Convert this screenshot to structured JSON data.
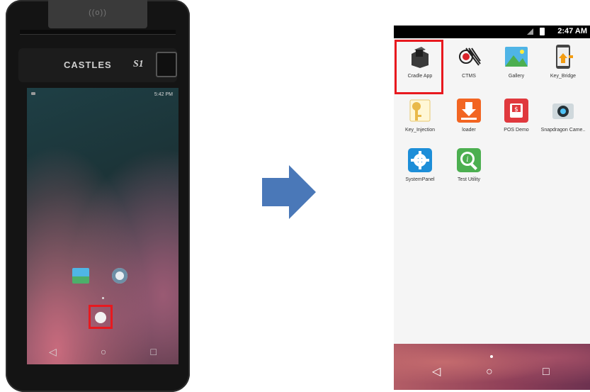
{
  "left_device": {
    "brand": "CASTLES",
    "model": "S1",
    "status_time": "5:42 PM"
  },
  "right_screen": {
    "status_time": "2:47 AM",
    "apps": [
      {
        "label": "Cradle App"
      },
      {
        "label": "CTMS"
      },
      {
        "label": "Gallery"
      },
      {
        "label": "Key_Bridge"
      },
      {
        "label": "Key_Injection"
      },
      {
        "label": "loader"
      },
      {
        "label": "POS Demo"
      },
      {
        "label": "Snapdragon Came.."
      },
      {
        "label": "SystemPanel"
      },
      {
        "label": "Test Utility"
      }
    ],
    "nav": {
      "back": "◁",
      "home": "○",
      "recents": "□"
    }
  },
  "colors": {
    "highlight": "#e8191f",
    "arrow": "#4a78b8"
  }
}
